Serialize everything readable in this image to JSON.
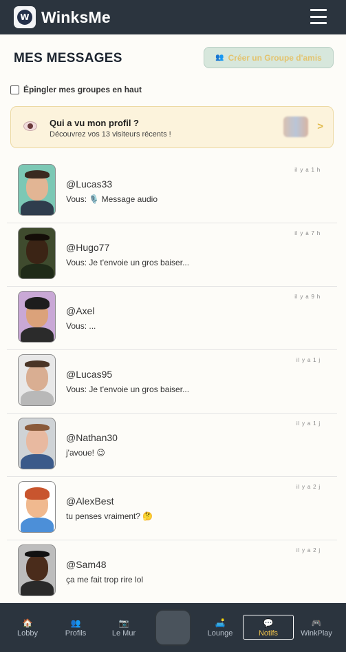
{
  "header": {
    "logo_letter": "W",
    "brand": "WinksMe",
    "menu_icon": "hamburger-icon"
  },
  "page": {
    "title": "MES MESSAGES",
    "group_button": {
      "icon": "people-icon",
      "label": "Créer un Groupe d'amis"
    },
    "pin_label": "Épingler mes groupes en haut",
    "pin_checked": false
  },
  "visitors": {
    "title": "Qui a vu mon profil ?",
    "subtitle": "Découvrez vos 13 visiteurs récents !",
    "arrow": ">",
    "icon": "eye-icon"
  },
  "messages": [
    {
      "name": "@Lucas33",
      "text": "Vous: 🎙️ Message audio",
      "time": "il y a 1 h"
    },
    {
      "name": "@Hugo77",
      "text": "Vous: Je t'envoie un gros baiser...",
      "time": "il y a 7 h"
    },
    {
      "name": "@Axel",
      "text": "Vous: ...",
      "time": "il y a 9 h"
    },
    {
      "name": "@Lucas95",
      "text": "Vous: Je t'envoie un gros baiser...",
      "time": "il y a 1 j"
    },
    {
      "name": "@Nathan30",
      "text": "j'avoue! 😉",
      "time": "il y a 1 j"
    },
    {
      "name": "@AlexBest",
      "text": "tu penses vraiment? 🤔",
      "time": "il y a 2 j"
    },
    {
      "name": "@Sam48",
      "text": "ça me fait trop rire lol",
      "time": "il y a 2 j"
    }
  ],
  "nav": {
    "lobby": "Lobby",
    "profils": "Profils",
    "mur": "Le Mur",
    "lounge": "Lounge",
    "notifs": "Notifs",
    "winkplay": "WinkPlay"
  },
  "colors": {
    "accent": "#f0c34a",
    "header_bg": "#2b343e",
    "page_bg": "#fdfcf8"
  }
}
